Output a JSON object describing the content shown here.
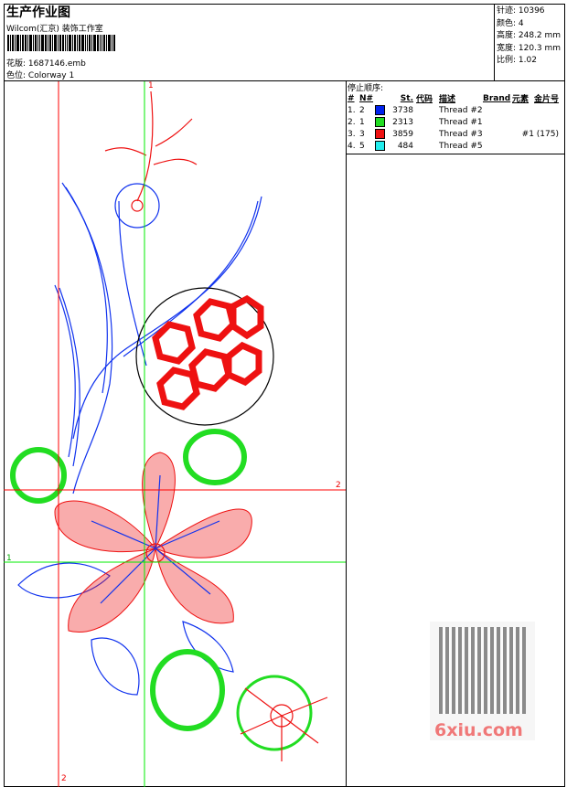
{
  "header": {
    "title": "生产作业图",
    "company": "Wilcom(汇京) 装饰工作室",
    "design_label": "花版:",
    "design_file": "1687146.emb",
    "colorway_label": "色位:",
    "colorway": "Colorway 1"
  },
  "stats": {
    "stitches": "针迹: 10396",
    "colors": "颜色: 4",
    "height": "高度: 248.2 mm",
    "width": "宽度: 120.3 mm",
    "scale": "比例: 1.02"
  },
  "stop_sequence": {
    "title": "停止顺序:",
    "headers": [
      "#",
      "N#",
      "St.",
      "代码",
      "描述",
      "Brand",
      "元素",
      "金片号"
    ],
    "rows": [
      {
        "idx": "1.",
        "n": "2",
        "color": "#0022ee",
        "st": "3738",
        "desc": "Thread #2",
        "sequin": ""
      },
      {
        "idx": "2.",
        "n": "1",
        "color": "#22dd22",
        "st": "2313",
        "desc": "Thread #1",
        "sequin": ""
      },
      {
        "idx": "3.",
        "n": "3",
        "color": "#ee1111",
        "st": "3859",
        "desc": "Thread #3",
        "sequin": "#1 (175)"
      },
      {
        "idx": "4.",
        "n": "5",
        "color": "#22eeee",
        "st": "484",
        "desc": "Thread #5",
        "sequin": ""
      }
    ]
  },
  "guides": {
    "top": "1",
    "right": "2",
    "left": "1",
    "bottom": "2"
  },
  "watermark": {
    "text": "6xiu.com"
  }
}
